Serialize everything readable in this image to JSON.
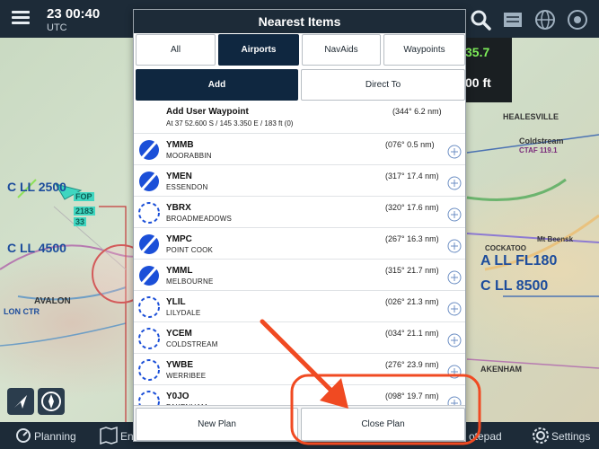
{
  "status_bar": {
    "time": "23 00:40",
    "zone": "UTC"
  },
  "map": {
    "readout_1": "35.7",
    "readout_2": "00 ft",
    "labels": [
      "C LL 2500",
      "C LL 4500",
      "C LL 8500",
      "A LL FL180",
      "AVALON",
      "LON CTR",
      "HEALESVILLE",
      "Coldstream",
      "CTAF 119.1",
      "Mt Beensk",
      "COCKATOO",
      "AKENHAM",
      "FOP",
      "2183",
      "33"
    ]
  },
  "bottom_bar": {
    "planning": "Planning",
    "notepad": "otepad",
    "settings": "Settings",
    "partial": "En"
  },
  "dialog": {
    "title": "Nearest Items",
    "tabs": [
      "All",
      "Airports",
      "NavAids",
      "Waypoints"
    ],
    "active_tab": "Airports",
    "actions": {
      "add": "Add",
      "direct_to": "Direct To"
    },
    "user_waypoint": {
      "title": "Add User Waypoint",
      "coords": "At 37 52.600 S / 145 3.350 E / 183 ft (0)",
      "distance": "(344° 6.2 nm)"
    },
    "airports": [
      {
        "code": "YMMB",
        "name": "MOORABBIN",
        "distance": "(076° 0.5 nm)",
        "towered": true
      },
      {
        "code": "YMEN",
        "name": "ESSENDON",
        "distance": "(317° 17.4 nm)",
        "towered": true
      },
      {
        "code": "YBRX",
        "name": "BROADMEADOWS",
        "distance": "(320° 17.6 nm)",
        "towered": false
      },
      {
        "code": "YMPC",
        "name": "POINT COOK",
        "distance": "(267° 16.3 nm)",
        "towered": true
      },
      {
        "code": "YMML",
        "name": "MELBOURNE",
        "distance": "(315° 21.7 nm)",
        "towered": true
      },
      {
        "code": "YLIL",
        "name": "LILYDALE",
        "distance": "(026° 21.3 nm)",
        "towered": false
      },
      {
        "code": "YCEM",
        "name": "COLDSTREAM",
        "distance": "(034° 21.1 nm)",
        "towered": false
      },
      {
        "code": "YWBE",
        "name": "WERRIBEE",
        "distance": "(276° 23.9 nm)",
        "towered": false
      },
      {
        "code": "Y0JO",
        "name": "PAKENHAM",
        "distance": "(098° 19.7 nm)",
        "towered": false
      }
    ],
    "footer": {
      "new_plan": "New Plan",
      "close_plan": "Close Plan"
    }
  },
  "colors": {
    "accent": "#0f2740",
    "airport_blue": "#1b4fd8",
    "annotation": "#f04a22",
    "header": "#1d2b38"
  }
}
